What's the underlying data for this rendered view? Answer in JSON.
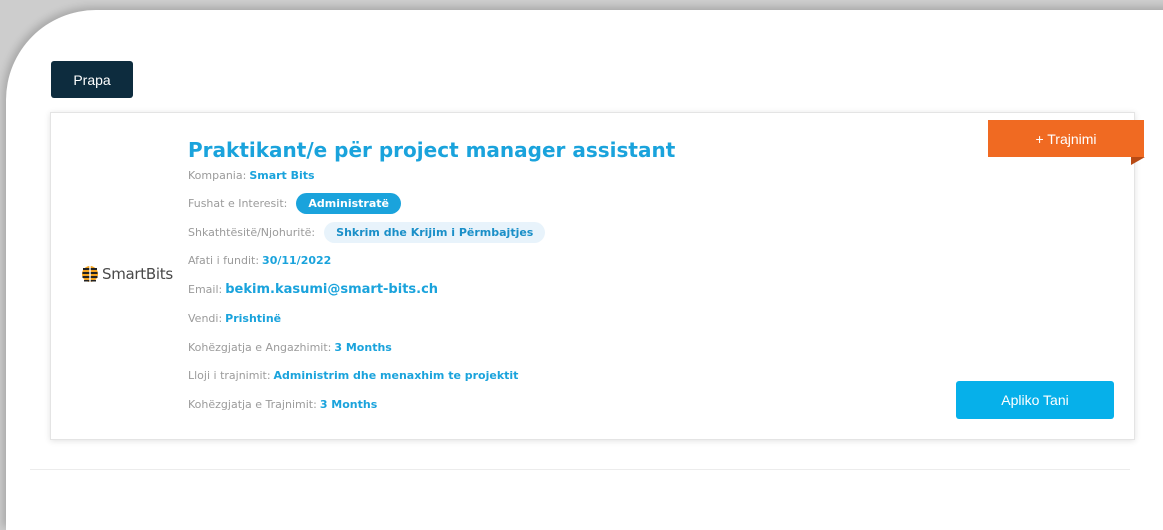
{
  "back_label": "Prapa",
  "ribbon_label": "+ Trajnimi",
  "company_logo_text": "SmartBits",
  "job": {
    "title": "Praktikant/e për project manager assistant",
    "company_label": "Kompania:",
    "company": "Smart Bits",
    "interest_label": "Fushat e Interesit:",
    "interest_chip": "Administratë",
    "skills_label": "Shkathtësitë/Njohuritë:",
    "skills_chip": "Shkrim dhe Krijim i Përmbajtjes",
    "deadline_label": "Afati i fundit:",
    "deadline": "30/11/2022",
    "email_label": "Email:",
    "email": "bekim.kasumi@smart-bits.ch",
    "location_label": "Vendi:",
    "location": "Prishtinë",
    "engagement_label": "Kohëzgjatja e Angazhimit:",
    "engagement": "3 Months",
    "training_type_label": "Lloji i trajnimit:",
    "training_type": "Administrim dhe menaxhim te projektit",
    "training_duration_label": "Kohëzgjatja e Trajnimit:",
    "training_duration": "3 Months"
  },
  "apply_label": "Apliko Tani",
  "colors": {
    "accent": "#1aa3dc",
    "dark_button": "#0d2c3e",
    "ribbon": "#f06a22",
    "apply": "#06b0ea"
  }
}
